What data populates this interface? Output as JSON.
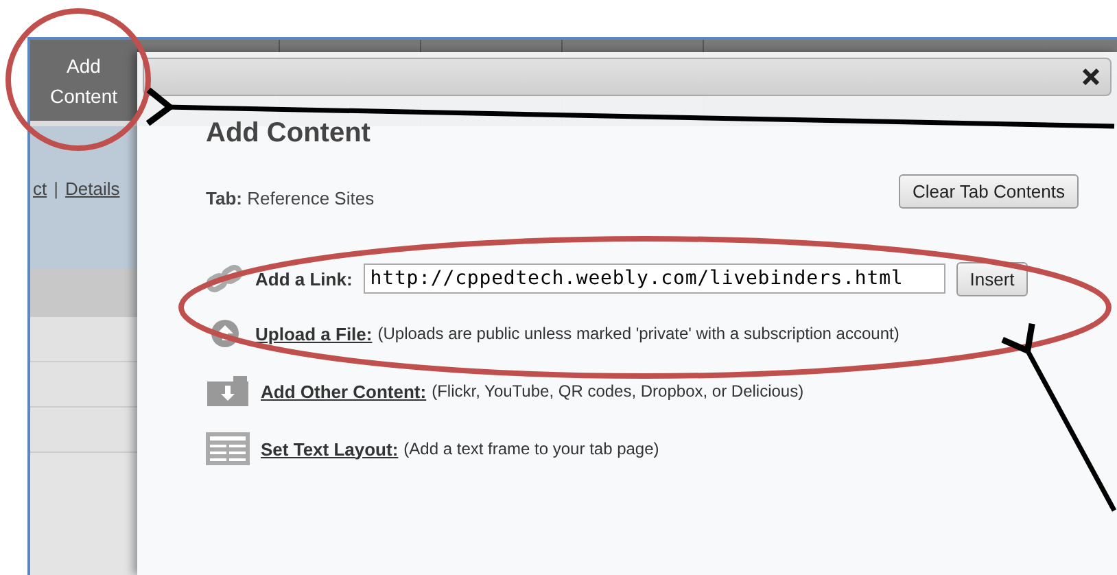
{
  "toolbar": {
    "add_button": "Add\nContent"
  },
  "links": [
    {
      "kind": "link",
      "text": "ct"
    },
    {
      "kind": "separator",
      "text": "|"
    },
    {
      "kind": "link",
      "text": "Details"
    }
  ],
  "dialog": {
    "title": "Add Content",
    "tab_line": "**Tab:** Reference Sites",
    "clear_button": "Clear Tab Contents",
    "rows": [
      {
        "kind": "link",
        "label": "Add a Link:",
        "value": "http://cppedtech.weebly.com/livebinders.html",
        "button": "Insert"
      },
      {
        "kind": "upload",
        "label": "Upload a File:",
        "note": "(Uploads are public unless marked 'private' with a subscription account)"
      },
      {
        "kind": "other",
        "label": "Add Other Content:",
        "note": "(Flickr, YouTube, QR codes, Dropbox, or Delicious)"
      },
      {
        "kind": "layout",
        "label": "Set Text Layout:",
        "note": "(Add a text frame to your tab page)"
      }
    ]
  }
}
